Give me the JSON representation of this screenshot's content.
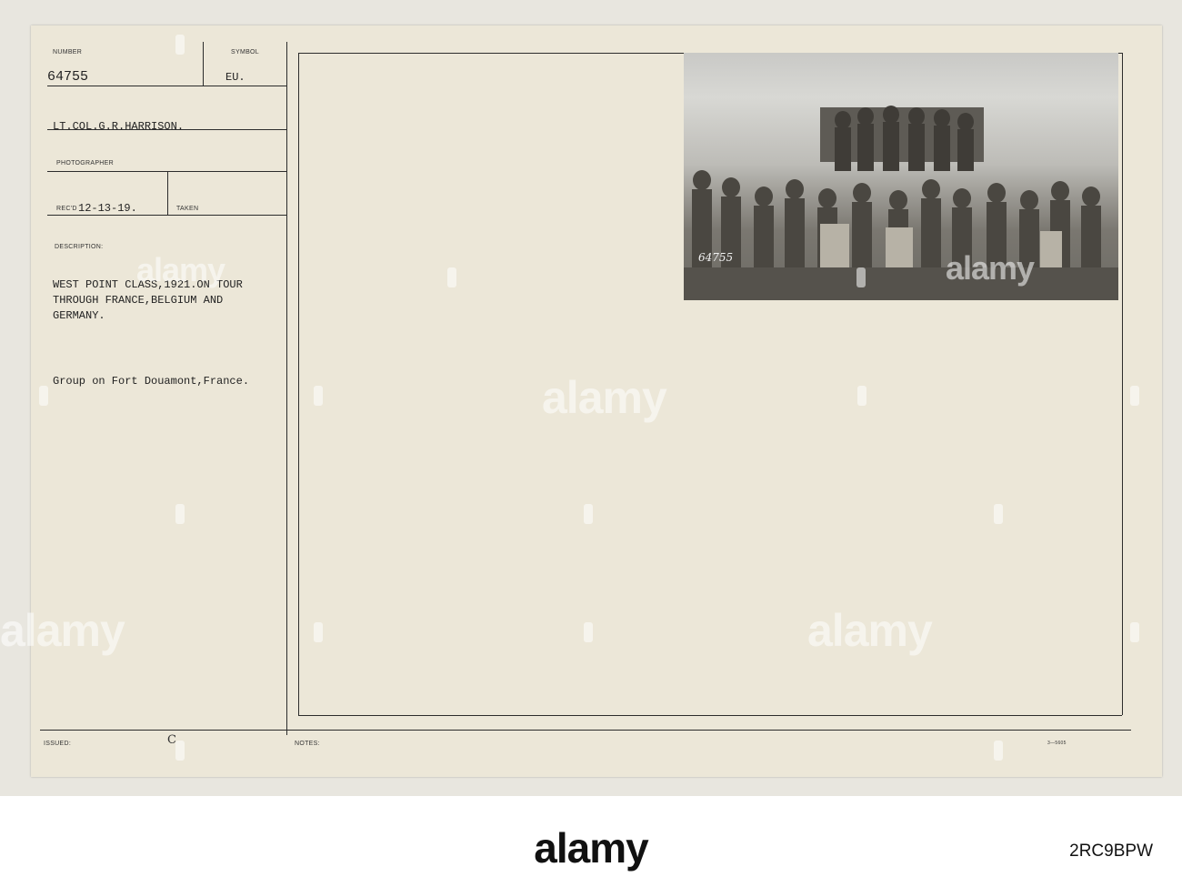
{
  "card": {
    "number_label": "NUMBER",
    "number": "64755",
    "symbol_label": "SYMBOL",
    "symbol": "EU.",
    "photographer": "LT.COL.G.R.HARRISON.",
    "photographer_label": "PHOTOGRAPHER",
    "recd_label": "REC'D",
    "recd_date": "12-13-19.",
    "taken_label": "TAKEN",
    "description_label": "DESCRIPTION:",
    "description_lines": [
      "WEST POINT CLASS,1921.ON TOUR",
      "THROUGH FRANCE,BELGIUM AND",
      "GERMANY."
    ],
    "caption": "Group on Fort Douamont,France.",
    "issued_label": "ISSUED:",
    "issued_value": "C",
    "notes_label": "NOTES:",
    "form_code": "3—5605",
    "photo_number": "64755"
  },
  "watermark": {
    "text": "alamy"
  },
  "footer": {
    "logo": "alamy",
    "image_id": "2RC9BPW"
  }
}
